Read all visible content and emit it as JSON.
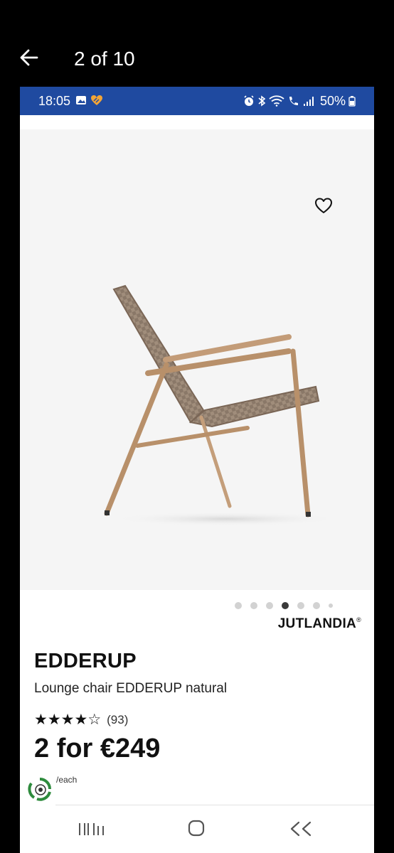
{
  "viewer": {
    "page_counter": "2 of 10"
  },
  "status_bar": {
    "time": "18:05",
    "battery": "50%"
  },
  "product": {
    "brand": "JUTLANDIA",
    "brand_mark": "®",
    "name": "EDDERUP",
    "description": "Lounge chair EDDERUP natural",
    "rating": 4,
    "rating_max": 5,
    "review_count": "(93)",
    "price": "2 for €249",
    "price_unit": "/each"
  },
  "gallery": {
    "total_images": 7,
    "active_index": 3
  },
  "colors": {
    "status_bar": "#1f4aa0",
    "image_background": "#f5f5f5",
    "chair_frame": "#b8906a",
    "chair_weave": "#8a7868",
    "eco_green": "#2e8b3d"
  },
  "icons": {
    "back": "arrow-left-icon",
    "favorite": "heart-outline-icon",
    "eco": "eco-badge-icon",
    "nav_recents": "recents-icon",
    "nav_home": "home-icon",
    "nav_back": "back-chevron-icon"
  }
}
